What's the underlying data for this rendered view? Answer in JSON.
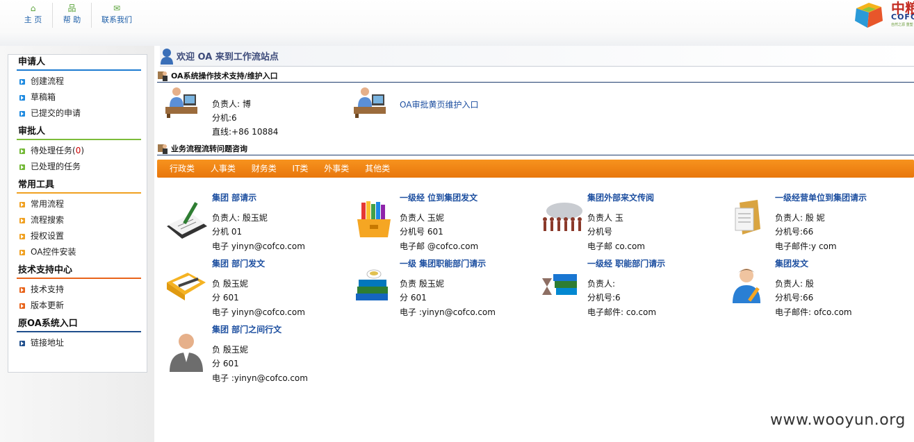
{
  "top_nav": [
    {
      "icon": "home-icon",
      "glyph": "⌂",
      "label": "主 页"
    },
    {
      "icon": "help-icon",
      "glyph": "品",
      "label": "帮 助"
    },
    {
      "icon": "mail-icon",
      "glyph": "✉",
      "label": "联系我们"
    }
  ],
  "logo": {
    "cn": "中粮",
    "en": "COFCO",
    "tagline": "自然之源 重塑"
  },
  "sidebar": {
    "sections": [
      {
        "title": "申请人",
        "items": [
          {
            "label": "创建流程"
          },
          {
            "label": "草稿箱"
          },
          {
            "label": "已提交的申请"
          }
        ]
      },
      {
        "title": "审批人",
        "items": [
          {
            "label": "待处理任务",
            "count_open": "(",
            "count": "0",
            "count_close": ")"
          },
          {
            "label": "已处理的任务"
          }
        ]
      },
      {
        "title": "常用工具",
        "items": [
          {
            "label": "常用流程"
          },
          {
            "label": "流程搜索"
          },
          {
            "label": "授权设置"
          },
          {
            "label": "OA控件安装"
          }
        ]
      },
      {
        "title": "技术支持中心",
        "items": [
          {
            "label": "技术支持"
          },
          {
            "label": "版本更新"
          }
        ]
      },
      {
        "title": "原OA系统入口",
        "items": [
          {
            "label": "链接地址"
          }
        ]
      }
    ]
  },
  "welcome": "欢迎 OA 来到工作流站点",
  "support_section": {
    "title": "OA系统操作技术支持/维护入口",
    "contact": {
      "name": "负责人: 博",
      "ext": "分机:6",
      "phone": "直线:+86 10884"
    },
    "maintenance_link": "OA审批黄页维护入口"
  },
  "consult_section": {
    "title": "业务流程流转问题咨询"
  },
  "categories": [
    "行政类",
    "人事类",
    "财务类",
    "IT类",
    "外事类",
    "其他类"
  ],
  "cards": [
    {
      "title": "集团 部请示",
      "l1": "负责人: 殷玉妮",
      "l2": "分机 01",
      "l3": "电子 yinyn@cofco.com"
    },
    {
      "title": "一级经 位到集团发文",
      "l1": "负责人 玉妮",
      "l2": "分机号 601",
      "l3": "电子邮 @cofco.com"
    },
    {
      "title": "集团外部来文传阅",
      "l1": "负责人 玉",
      "l2": "分机号",
      "l3": "电子邮 co.com"
    },
    {
      "title": "一级经营单位到集团请示",
      "l1": "负责人: 殷 妮",
      "l2": "分机号:66",
      "l3": "电子邮件:y com"
    },
    {
      "title": "集团 部门发文",
      "l1": "负 殷玉妮",
      "l2": "分 601",
      "l3": "电子 yinyn@cofco.com"
    },
    {
      "title": "一级 集团职能部门请示",
      "l1": "负责 殷玉妮",
      "l2": "分 601",
      "l3": "电子 :yinyn@cofco.com"
    },
    {
      "title": "一级经 职能部门请示",
      "l1": "负责人:",
      "l2": "分机号:6",
      "l3": "电子邮件: co.com"
    },
    {
      "title": "集团发文",
      "l1": "负责人: 殷",
      "l2": "分机号:66",
      "l3": "电子邮件: ofco.com"
    },
    {
      "title": "集团 部门之间行文",
      "l1": "负 殷玉妮",
      "l2": "分 601",
      "l3": "电子 :yinyn@cofco.com"
    }
  ],
  "watermark": "www.wooyun.org",
  "colors": {
    "accent_blue": "#1d4fa0",
    "orange_bar": "#f08a17",
    "sidebar_red": "#e8631a"
  }
}
